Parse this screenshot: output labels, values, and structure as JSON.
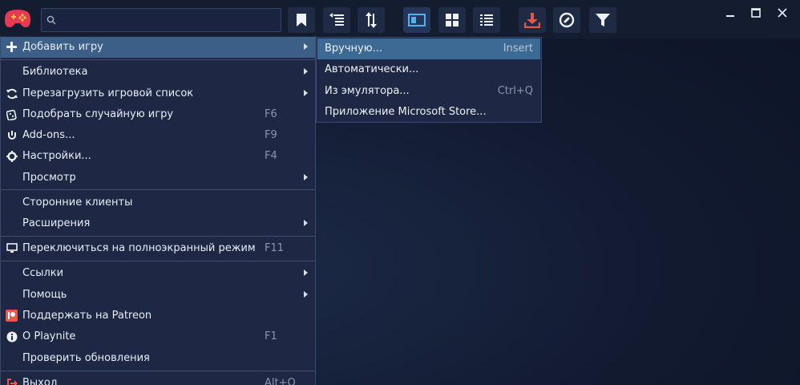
{
  "app": {
    "window_controls": {
      "minimize": "—",
      "maximize": "☐",
      "close": "✕"
    }
  },
  "search": {
    "placeholder": "",
    "value": ""
  },
  "toolbar": [
    {
      "icon": "bookmark-icon"
    },
    {
      "icon": "sort-list-icon"
    },
    {
      "icon": "sort-order-icon"
    },
    {
      "icon": "sidebar-view-icon"
    },
    {
      "icon": "grid-view-icon"
    },
    {
      "icon": "list-view-icon"
    },
    {
      "icon": "download-icon"
    },
    {
      "icon": "random-icon"
    },
    {
      "icon": "filter-icon"
    }
  ],
  "colors": {
    "accent": "#3c5f87",
    "download": "#e2574c",
    "patreon": "#e8584d"
  },
  "menu": {
    "items": [
      {
        "label": "Добавить игру",
        "shortcut": "",
        "submenu": true,
        "icon": "plus-icon"
      },
      {
        "label": "Библиотека",
        "shortcut": "",
        "submenu": true,
        "icon": ""
      },
      {
        "label": "Перезагрузить игровой список",
        "shortcut": "",
        "submenu": true,
        "icon": "reload-icon"
      },
      {
        "label": "Подобрать случайную игру",
        "shortcut": "F6",
        "submenu": false,
        "icon": "dice-icon"
      },
      {
        "label": "Add-ons...",
        "shortcut": "F9",
        "submenu": false,
        "icon": "plug-icon"
      },
      {
        "label": "Настройки...",
        "shortcut": "F4",
        "submenu": false,
        "icon": "gear-icon"
      },
      {
        "label": "Просмотр",
        "shortcut": "",
        "submenu": true,
        "icon": ""
      },
      {
        "label": "Сторонние клиенты",
        "shortcut": "",
        "submenu": false,
        "icon": ""
      },
      {
        "label": "Расширения",
        "shortcut": "",
        "submenu": true,
        "icon": ""
      },
      {
        "label": "Переключиться на полноэкранный режим",
        "shortcut": "F11",
        "submenu": false,
        "icon": "monitor-icon"
      },
      {
        "label": "Ссылки",
        "shortcut": "",
        "submenu": true,
        "icon": ""
      },
      {
        "label": "Помощь",
        "shortcut": "",
        "submenu": true,
        "icon": ""
      },
      {
        "label": "Поддержать на Patreon",
        "shortcut": "",
        "submenu": false,
        "icon": "patreon-icon"
      },
      {
        "label": "О Playnite",
        "shortcut": "F1",
        "submenu": false,
        "icon": "info-icon"
      },
      {
        "label": "Проверить обновления",
        "shortcut": "",
        "submenu": false,
        "icon": ""
      },
      {
        "label": "Выход",
        "shortcut": "Alt+Q",
        "submenu": false,
        "icon": "exit-icon"
      }
    ]
  },
  "submenu": {
    "items": [
      {
        "label": "Вручную...",
        "shortcut": "Insert"
      },
      {
        "label": "Автоматически...",
        "shortcut": ""
      },
      {
        "label": "Из эмулятора...",
        "shortcut": "Ctrl+Q"
      },
      {
        "label": "Приложение Microsoft Store...",
        "shortcut": ""
      }
    ]
  }
}
